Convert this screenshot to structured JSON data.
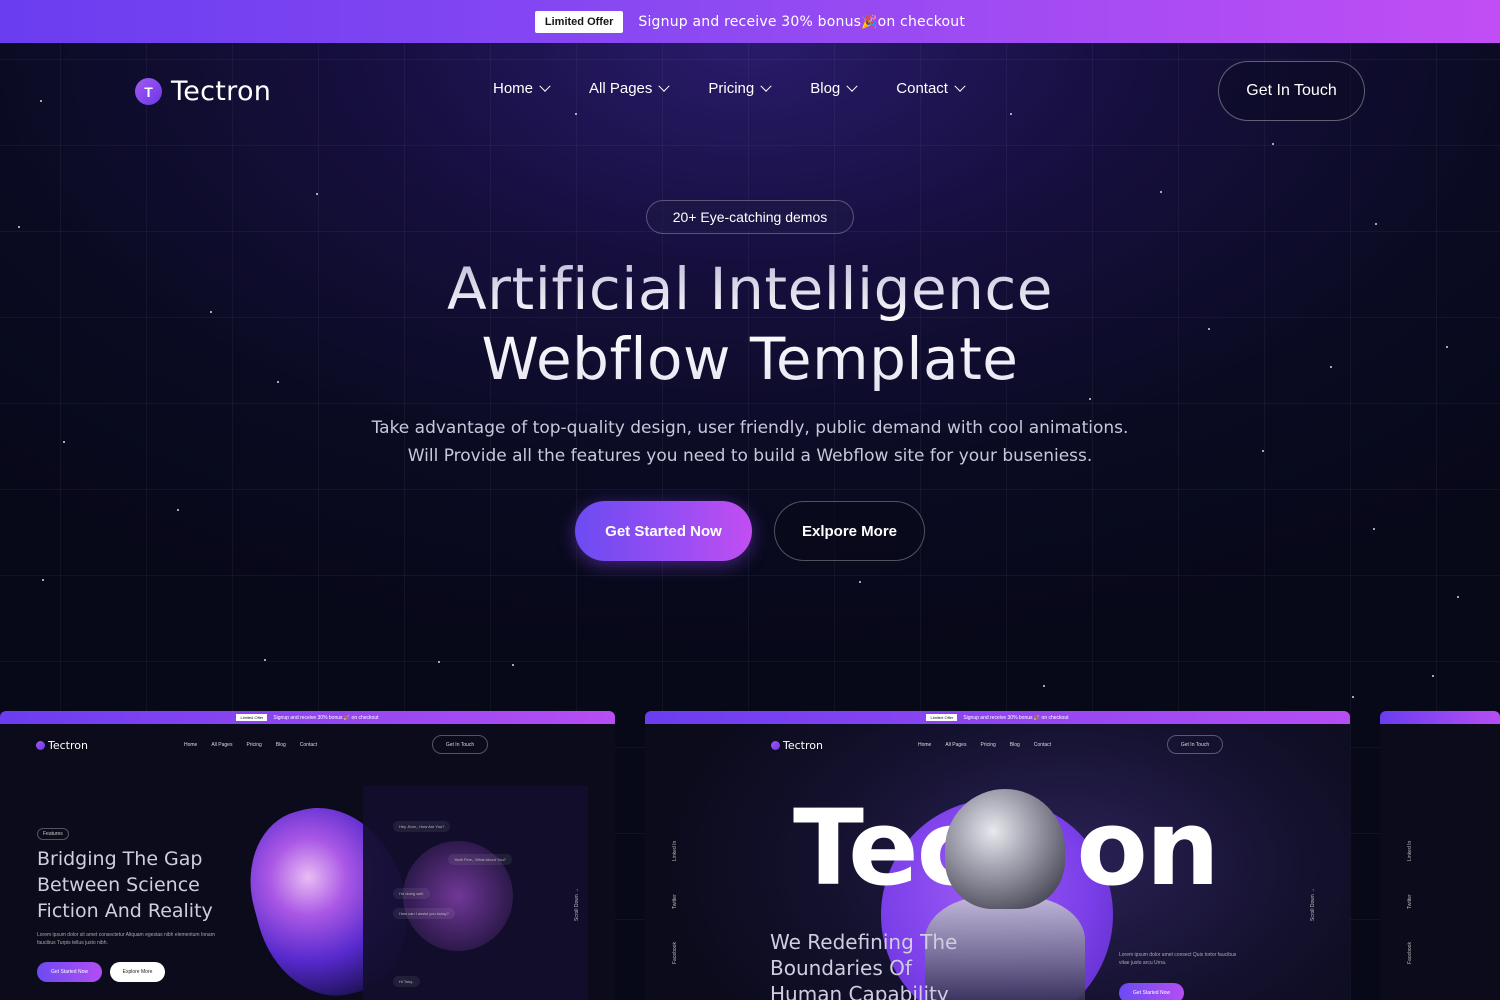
{
  "announcement": {
    "badge": "Limited Offer",
    "message": "Signup and receive 30% bonus",
    "emoji": "🎉",
    "message_end": "on checkout"
  },
  "brand": {
    "logo_letter": "T",
    "name": "Tectron"
  },
  "nav": {
    "items": [
      {
        "label": "Home"
      },
      {
        "label": "All Pages"
      },
      {
        "label": "Pricing"
      },
      {
        "label": "Blog"
      },
      {
        "label": "Contact"
      }
    ],
    "cta": "Get In Touch"
  },
  "hero": {
    "pill": "20+ Eye-catching demos",
    "title_line1": "Artificial Intelligence",
    "title_line2": "Webflow Template",
    "subtitle_line1": "Take advantage of top-quality design, user friendly, public demand with cool animations.",
    "subtitle_line2": "Will Provide all the features you need to build a Webflow site for your buseniess.",
    "primary_cta": "Get Started Now",
    "secondary_cta": "Exlpore More"
  },
  "previews": {
    "card1": {
      "top_badge": "Limited Offer",
      "top_msg": "Signup and receive 30% bonus 🎉 on checkout",
      "logo": "Tectron",
      "links": [
        "Home",
        "All Pages",
        "Pricing",
        "Blog",
        "Contact"
      ],
      "touch": "Get In Touch",
      "chip": "Features",
      "headline": "Bridging The Gap Between Science Fiction And Reality",
      "para": "Lorem ipsum dolor sit amet consectetur Aliquam egestas nibh elementum Innam faucibus Turpis tellus justo nibh.",
      "btn_primary": "Get Started Now",
      "btn_secondary": "Explore More",
      "chat": [
        "Hey Jhon,, How Are You?",
        "Yeah Fine,, What About You?",
        "I'm doing well.",
        "How can I assist you today?",
        "Hi Tony.."
      ],
      "side_scroll": "Scroll Down →"
    },
    "card2": {
      "top_badge": "Limited Offer",
      "top_msg": "Signup and receive 30% bonus 🎉 on checkout",
      "logo": "Tectron",
      "links": [
        "Home",
        "All Pages",
        "Pricing",
        "Blog",
        "Contact"
      ],
      "touch": "Get In Touch",
      "big_word_left": "Tec",
      "big_word_right": "on",
      "tagline": "We Redefining The Boundaries Of Human Capability",
      "para": "Lorem ipsum dolor amet consect Quis tortor faucibus vitae justo arcu Urna.",
      "btn": "Get Started Now",
      "social": [
        "Linked In",
        "Twitter",
        "Facebook"
      ],
      "side_scroll": "Scroll Down →"
    },
    "card3": {
      "social": [
        "Linked In",
        "Twitter",
        "Facebook"
      ]
    }
  },
  "colors": {
    "accent_start": "#6a3df0",
    "accent_end": "#c14ef4",
    "background": "#0a0b22"
  }
}
